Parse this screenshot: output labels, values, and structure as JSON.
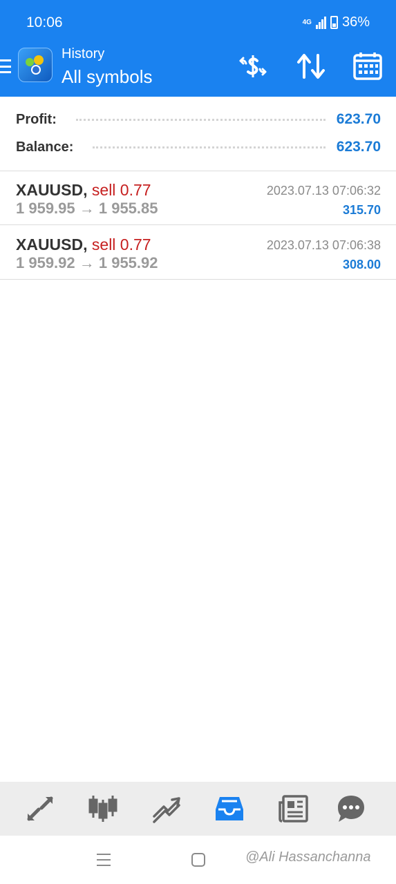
{
  "status_bar": {
    "time": "10:06",
    "network": "4G",
    "battery": "36%"
  },
  "header": {
    "subtitle": "History",
    "title": "All symbols"
  },
  "summary": {
    "profit_label": "Profit:",
    "profit_value": "623.70",
    "balance_label": "Balance:",
    "balance_value": "623.70"
  },
  "deals": [
    {
      "symbol": "XAUUSD,",
      "type": "sell 0.77",
      "time": "2023.07.13 07:06:32",
      "prices": "1 959.95 → 1 955.85",
      "profit": "315.70"
    },
    {
      "symbol": "XAUUSD,",
      "type": "sell 0.77",
      "time": "2023.07.13 07:06:38",
      "prices": "1 959.92 → 1 955.92",
      "profit": "308.00"
    }
  ],
  "bottom_nav": [
    "quotes-icon",
    "chart-icon",
    "trade-icon",
    "history-icon",
    "news-icon",
    "messages-icon"
  ],
  "watermark": "@Ali Hassanchanna",
  "colors": {
    "accent": "#1a82f0",
    "profit": "#1b7bd6",
    "sell": "#c62020"
  }
}
